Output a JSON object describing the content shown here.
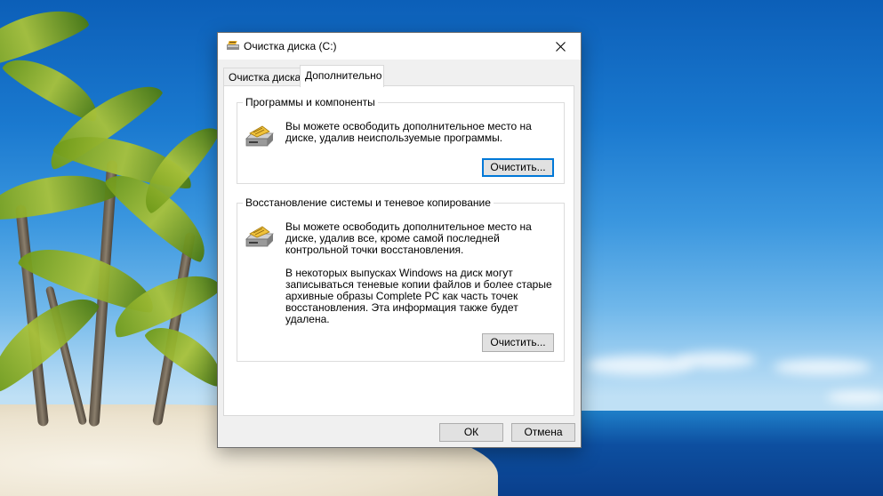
{
  "window": {
    "title": "Очистка диска  (C:)",
    "tabs": [
      {
        "label": "Очистка диска"
      },
      {
        "label": "Дополнительно"
      }
    ],
    "active_tab": "Дополнительно",
    "groups": [
      {
        "title": "Программы и компоненты",
        "icon": "disk-cleanup-drive-icon",
        "text": "Вы можете освободить дополнительное место на диске, удалив неиспользуемые программы.",
        "button_label": "Очистить..."
      },
      {
        "title": "Восстановление системы и теневое копирование",
        "icon": "disk-cleanup-drive-icon",
        "text": "Вы можете освободить дополнительное место на диске, удалив все, кроме самой последней контрольной точки восстановления.",
        "text2": "В некоторых выпусках Windows на диск могут записываться теневые копии файлов и более старые архивные образы Complete PC как часть точек восстановления. Эта информация также будет удалена.",
        "button_label": "Очистить..."
      }
    ],
    "ok_label": "ОК",
    "cancel_label": "Отмена"
  },
  "colors": {
    "accent": "#0078d7",
    "dialog_bg": "#f0f0f0",
    "button_bg": "#e1e1e1"
  }
}
